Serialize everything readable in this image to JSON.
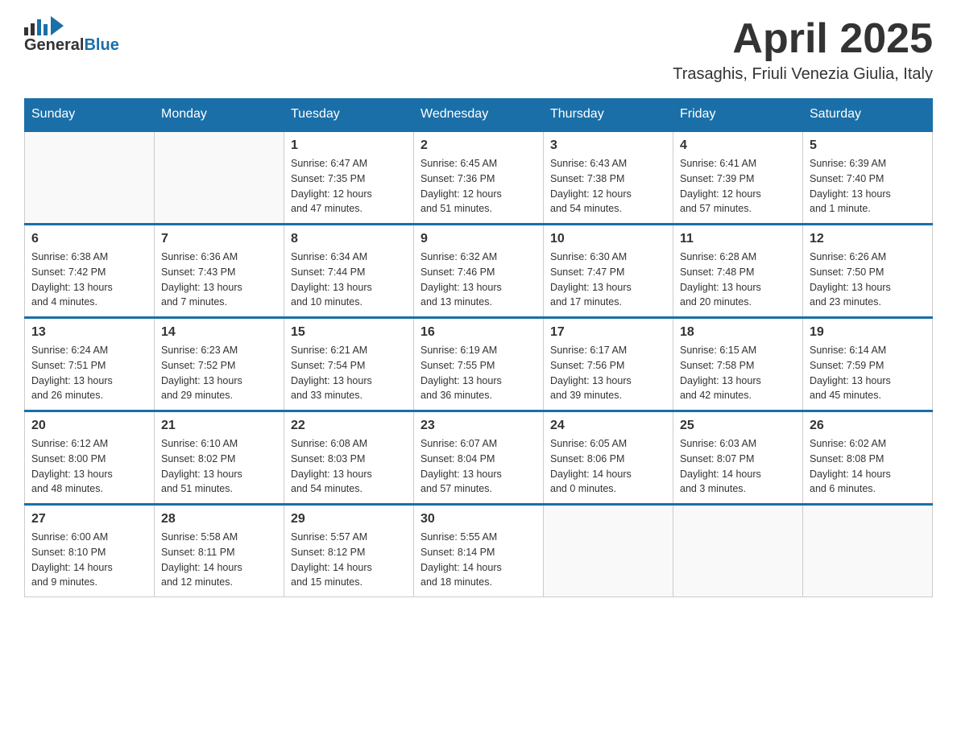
{
  "header": {
    "title": "April 2025",
    "subtitle": "Trasaghis, Friuli Venezia Giulia, Italy",
    "logo_general": "General",
    "logo_blue": "Blue"
  },
  "calendar": {
    "days_of_week": [
      "Sunday",
      "Monday",
      "Tuesday",
      "Wednesday",
      "Thursday",
      "Friday",
      "Saturday"
    ],
    "weeks": [
      [
        {
          "day": "",
          "info": ""
        },
        {
          "day": "",
          "info": ""
        },
        {
          "day": "1",
          "info": "Sunrise: 6:47 AM\nSunset: 7:35 PM\nDaylight: 12 hours\nand 47 minutes."
        },
        {
          "day": "2",
          "info": "Sunrise: 6:45 AM\nSunset: 7:36 PM\nDaylight: 12 hours\nand 51 minutes."
        },
        {
          "day": "3",
          "info": "Sunrise: 6:43 AM\nSunset: 7:38 PM\nDaylight: 12 hours\nand 54 minutes."
        },
        {
          "day": "4",
          "info": "Sunrise: 6:41 AM\nSunset: 7:39 PM\nDaylight: 12 hours\nand 57 minutes."
        },
        {
          "day": "5",
          "info": "Sunrise: 6:39 AM\nSunset: 7:40 PM\nDaylight: 13 hours\nand 1 minute."
        }
      ],
      [
        {
          "day": "6",
          "info": "Sunrise: 6:38 AM\nSunset: 7:42 PM\nDaylight: 13 hours\nand 4 minutes."
        },
        {
          "day": "7",
          "info": "Sunrise: 6:36 AM\nSunset: 7:43 PM\nDaylight: 13 hours\nand 7 minutes."
        },
        {
          "day": "8",
          "info": "Sunrise: 6:34 AM\nSunset: 7:44 PM\nDaylight: 13 hours\nand 10 minutes."
        },
        {
          "day": "9",
          "info": "Sunrise: 6:32 AM\nSunset: 7:46 PM\nDaylight: 13 hours\nand 13 minutes."
        },
        {
          "day": "10",
          "info": "Sunrise: 6:30 AM\nSunset: 7:47 PM\nDaylight: 13 hours\nand 17 minutes."
        },
        {
          "day": "11",
          "info": "Sunrise: 6:28 AM\nSunset: 7:48 PM\nDaylight: 13 hours\nand 20 minutes."
        },
        {
          "day": "12",
          "info": "Sunrise: 6:26 AM\nSunset: 7:50 PM\nDaylight: 13 hours\nand 23 minutes."
        }
      ],
      [
        {
          "day": "13",
          "info": "Sunrise: 6:24 AM\nSunset: 7:51 PM\nDaylight: 13 hours\nand 26 minutes."
        },
        {
          "day": "14",
          "info": "Sunrise: 6:23 AM\nSunset: 7:52 PM\nDaylight: 13 hours\nand 29 minutes."
        },
        {
          "day": "15",
          "info": "Sunrise: 6:21 AM\nSunset: 7:54 PM\nDaylight: 13 hours\nand 33 minutes."
        },
        {
          "day": "16",
          "info": "Sunrise: 6:19 AM\nSunset: 7:55 PM\nDaylight: 13 hours\nand 36 minutes."
        },
        {
          "day": "17",
          "info": "Sunrise: 6:17 AM\nSunset: 7:56 PM\nDaylight: 13 hours\nand 39 minutes."
        },
        {
          "day": "18",
          "info": "Sunrise: 6:15 AM\nSunset: 7:58 PM\nDaylight: 13 hours\nand 42 minutes."
        },
        {
          "day": "19",
          "info": "Sunrise: 6:14 AM\nSunset: 7:59 PM\nDaylight: 13 hours\nand 45 minutes."
        }
      ],
      [
        {
          "day": "20",
          "info": "Sunrise: 6:12 AM\nSunset: 8:00 PM\nDaylight: 13 hours\nand 48 minutes."
        },
        {
          "day": "21",
          "info": "Sunrise: 6:10 AM\nSunset: 8:02 PM\nDaylight: 13 hours\nand 51 minutes."
        },
        {
          "day": "22",
          "info": "Sunrise: 6:08 AM\nSunset: 8:03 PM\nDaylight: 13 hours\nand 54 minutes."
        },
        {
          "day": "23",
          "info": "Sunrise: 6:07 AM\nSunset: 8:04 PM\nDaylight: 13 hours\nand 57 minutes."
        },
        {
          "day": "24",
          "info": "Sunrise: 6:05 AM\nSunset: 8:06 PM\nDaylight: 14 hours\nand 0 minutes."
        },
        {
          "day": "25",
          "info": "Sunrise: 6:03 AM\nSunset: 8:07 PM\nDaylight: 14 hours\nand 3 minutes."
        },
        {
          "day": "26",
          "info": "Sunrise: 6:02 AM\nSunset: 8:08 PM\nDaylight: 14 hours\nand 6 minutes."
        }
      ],
      [
        {
          "day": "27",
          "info": "Sunrise: 6:00 AM\nSunset: 8:10 PM\nDaylight: 14 hours\nand 9 minutes."
        },
        {
          "day": "28",
          "info": "Sunrise: 5:58 AM\nSunset: 8:11 PM\nDaylight: 14 hours\nand 12 minutes."
        },
        {
          "day": "29",
          "info": "Sunrise: 5:57 AM\nSunset: 8:12 PM\nDaylight: 14 hours\nand 15 minutes."
        },
        {
          "day": "30",
          "info": "Sunrise: 5:55 AM\nSunset: 8:14 PM\nDaylight: 14 hours\nand 18 minutes."
        },
        {
          "day": "",
          "info": ""
        },
        {
          "day": "",
          "info": ""
        },
        {
          "day": "",
          "info": ""
        }
      ]
    ]
  }
}
